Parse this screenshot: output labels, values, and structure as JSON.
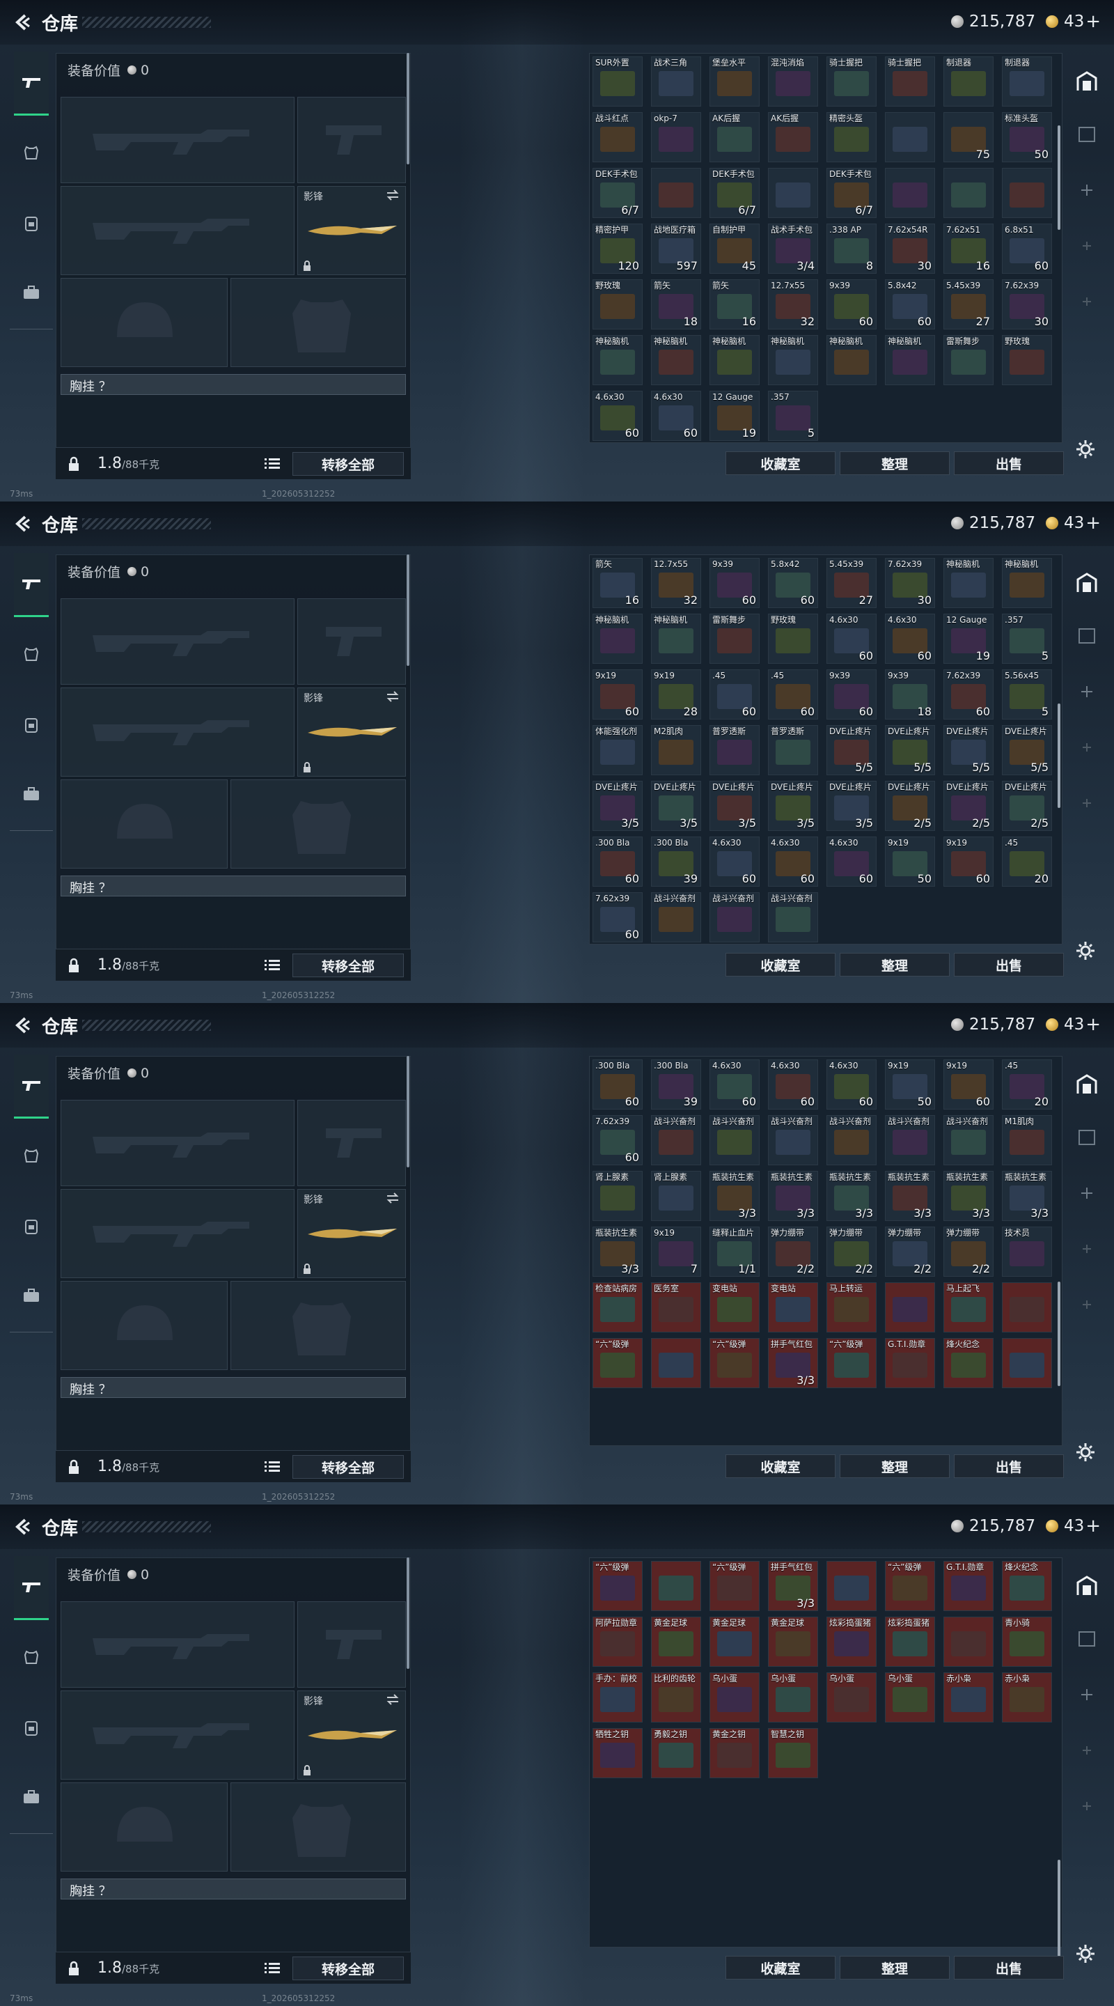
{
  "header": {
    "title": "仓库",
    "silver": "215,787",
    "gold": "43",
    "gold_plus": "+"
  },
  "loadout": {
    "equip_value_label": "装备价值",
    "equip_value": "0",
    "melee_label": "影锋",
    "chest_label": "胸挂 ？",
    "weight": "1.8",
    "weight_cap": "/88千克",
    "transfer_all": "转移全部"
  },
  "inventory_actions": {
    "collection": "收藏室",
    "organize": "整理",
    "sell": "出售"
  },
  "status": {
    "ping": "73ms",
    "build": "1_202605312252"
  },
  "icons": [
    "back-icon",
    "gun-tab-icon",
    "armor-tab-icon",
    "backpack-tab-icon",
    "case-tab-icon",
    "vault-icon",
    "list-icon",
    "lock-icon",
    "swap-icon",
    "gear-icon",
    "plus-icon"
  ],
  "frames": [
    {
      "cells": [
        {
          "name": "SUR外置",
          "count": ""
        },
        {
          "name": "战术三角",
          "count": ""
        },
        {
          "name": "堡垒水平",
          "count": ""
        },
        {
          "name": "混沌消焰",
          "count": ""
        },
        {
          "name": "骑士握把",
          "count": ""
        },
        {
          "name": "骑士握把",
          "count": ""
        },
        {
          "name": "制退器",
          "count": ""
        },
        {
          "name": "制退器",
          "count": ""
        },
        {
          "name": "战斗红点",
          "count": ""
        },
        {
          "name": "okp-7",
          "count": ""
        },
        {
          "name": "AK后握",
          "count": ""
        },
        {
          "name": "AK后握",
          "count": ""
        },
        {
          "name": "精密头盔",
          "count": ""
        },
        {
          "name": "",
          "count": ""
        },
        {
          "name": "",
          "count": "75"
        },
        {
          "name": "标准头盔",
          "count": "50"
        },
        {
          "name": "DEK手术包",
          "count": "6/7"
        },
        {
          "name": "",
          "count": ""
        },
        {
          "name": "DEK手术包",
          "count": "6/7"
        },
        {
          "name": "",
          "count": ""
        },
        {
          "name": "DEK手术包",
          "count": "6/7"
        },
        {
          "name": "",
          "count": ""
        },
        {
          "name": "",
          "count": ""
        },
        {
          "name": "",
          "count": ""
        },
        {
          "name": "精密护甲",
          "count": "120"
        },
        {
          "name": "战地医疗箱",
          "count": "597"
        },
        {
          "name": "自制护甲",
          "count": "45"
        },
        {
          "name": "战术手术包",
          "count": "3/4"
        },
        {
          "name": ".338 AP",
          "count": "8"
        },
        {
          "name": "7.62x54R",
          "count": "30"
        },
        {
          "name": "7.62x51",
          "count": "16"
        },
        {
          "name": "6.8x51",
          "count": "60"
        },
        {
          "name": "野玫瑰",
          "count": ""
        },
        {
          "name": "箭矢",
          "count": "18"
        },
        {
          "name": "箭矢",
          "count": "16"
        },
        {
          "name": "12.7x55",
          "count": "32"
        },
        {
          "name": "9x39",
          "count": "60"
        },
        {
          "name": "5.8x42",
          "count": "60"
        },
        {
          "name": "5.45x39",
          "count": "27"
        },
        {
          "name": "7.62x39",
          "count": "30"
        },
        {
          "name": "神秘脑机",
          "count": ""
        },
        {
          "name": "神秘脑机",
          "count": ""
        },
        {
          "name": "神秘脑机",
          "count": ""
        },
        {
          "name": "神秘脑机",
          "count": ""
        },
        {
          "name": "神秘脑机",
          "count": ""
        },
        {
          "name": "神秘脑机",
          "count": ""
        },
        {
          "name": "雷斯舞步",
          "count": ""
        },
        {
          "name": "野玫瑰",
          "count": ""
        },
        {
          "name": "4.6x30",
          "count": "60"
        },
        {
          "name": "4.6x30",
          "count": "60"
        },
        {
          "name": "12 Gauge",
          "count": "19"
        },
        {
          "name": ".357",
          "count": "5"
        }
      ]
    },
    {
      "cells": [
        {
          "name": "箭矢",
          "count": "16"
        },
        {
          "name": "12.7x55",
          "count": "32"
        },
        {
          "name": "9x39",
          "count": "60"
        },
        {
          "name": "5.8x42",
          "count": "60"
        },
        {
          "name": "5.45x39",
          "count": "27"
        },
        {
          "name": "7.62x39",
          "count": "30"
        },
        {
          "name": "神秘脑机",
          "count": ""
        },
        {
          "name": "神秘脑机",
          "count": ""
        },
        {
          "name": "神秘脑机",
          "count": ""
        },
        {
          "name": "神秘脑机",
          "count": ""
        },
        {
          "name": "雷斯舞步",
          "count": ""
        },
        {
          "name": "野玫瑰",
          "count": ""
        },
        {
          "name": "4.6x30",
          "count": "60"
        },
        {
          "name": "4.6x30",
          "count": "60"
        },
        {
          "name": "12 Gauge",
          "count": "19"
        },
        {
          "name": ".357",
          "count": "5"
        },
        {
          "name": "9x19",
          "count": "60"
        },
        {
          "name": "9x19",
          "count": "28"
        },
        {
          "name": ".45",
          "count": "60"
        },
        {
          "name": ".45",
          "count": "60"
        },
        {
          "name": "9x39",
          "count": "60"
        },
        {
          "name": "9x39",
          "count": "18"
        },
        {
          "name": "7.62x39",
          "count": "60"
        },
        {
          "name": "5.56x45",
          "count": "5"
        },
        {
          "name": "体能强化剂",
          "count": ""
        },
        {
          "name": "M2肌肉",
          "count": ""
        },
        {
          "name": "普罗透斯",
          "count": ""
        },
        {
          "name": "普罗透斯",
          "count": ""
        },
        {
          "name": "DVE止疼片",
          "count": "5/5"
        },
        {
          "name": "DVE止疼片",
          "count": "5/5"
        },
        {
          "name": "DVE止疼片",
          "count": "5/5"
        },
        {
          "name": "DVE止疼片",
          "count": "5/5"
        },
        {
          "name": "DVE止疼片",
          "count": "3/5"
        },
        {
          "name": "DVE止疼片",
          "count": "3/5"
        },
        {
          "name": "DVE止疼片",
          "count": "3/5"
        },
        {
          "name": "DVE止疼片",
          "count": "3/5"
        },
        {
          "name": "DVE止疼片",
          "count": "3/5"
        },
        {
          "name": "DVE止疼片",
          "count": "2/5"
        },
        {
          "name": "DVE止疼片",
          "count": "2/5"
        },
        {
          "name": "DVE止疼片",
          "count": "2/5"
        },
        {
          "name": ".300 Bla",
          "count": "60"
        },
        {
          "name": ".300 Bla",
          "count": "39"
        },
        {
          "name": "4.6x30",
          "count": "60"
        },
        {
          "name": "4.6x30",
          "count": "60"
        },
        {
          "name": "4.6x30",
          "count": "60"
        },
        {
          "name": "9x19",
          "count": "50"
        },
        {
          "name": "9x19",
          "count": "60"
        },
        {
          "name": ".45",
          "count": "20"
        },
        {
          "name": "7.62x39",
          "count": "60"
        },
        {
          "name": "战斗兴奋剂",
          "count": ""
        },
        {
          "name": "战斗兴奋剂",
          "count": ""
        },
        {
          "name": "战斗兴奋剂",
          "count": ""
        }
      ]
    },
    {
      "cells": [
        {
          "name": ".300 Bla",
          "count": "60"
        },
        {
          "name": ".300 Bla",
          "count": "39"
        },
        {
          "name": "4.6x30",
          "count": "60"
        },
        {
          "name": "4.6x30",
          "count": "60"
        },
        {
          "name": "4.6x30",
          "count": "60"
        },
        {
          "name": "9x19",
          "count": "50"
        },
        {
          "name": "9x19",
          "count": "60"
        },
        {
          "name": ".45",
          "count": "20"
        },
        {
          "name": "7.62x39",
          "count": "60"
        },
        {
          "name": "战斗兴奋剂",
          "count": ""
        },
        {
          "name": "战斗兴奋剂",
          "count": ""
        },
        {
          "name": "战斗兴奋剂",
          "count": ""
        },
        {
          "name": "战斗兴奋剂",
          "count": ""
        },
        {
          "name": "战斗兴奋剂",
          "count": ""
        },
        {
          "name": "战斗兴奋剂",
          "count": ""
        },
        {
          "name": "M1肌肉",
          "count": ""
        },
        {
          "name": "肾上腺素",
          "count": ""
        },
        {
          "name": "肾上腺素",
          "count": ""
        },
        {
          "name": "瓶装抗生素",
          "count": "3/3"
        },
        {
          "name": "瓶装抗生素",
          "count": "3/3"
        },
        {
          "name": "瓶装抗生素",
          "count": "3/3"
        },
        {
          "name": "瓶装抗生素",
          "count": "3/3"
        },
        {
          "name": "瓶装抗生素",
          "count": "3/3"
        },
        {
          "name": "瓶装抗生素",
          "count": "3/3"
        },
        {
          "name": "瓶装抗生素",
          "count": "3/3"
        },
        {
          "name": "9x19",
          "count": "7"
        },
        {
          "name": "缝释止血片",
          "count": "1/1"
        },
        {
          "name": "弹力绷带",
          "count": "2/2"
        },
        {
          "name": "弹力绷带",
          "count": "2/2"
        },
        {
          "name": "弹力绷带",
          "count": "2/2"
        },
        {
          "name": "弹力绷带",
          "count": "2/2"
        },
        {
          "name": "技术员",
          "count": ""
        },
        {
          "name": "检查站病房",
          "count": ""
        },
        {
          "name": "医务室",
          "count": ""
        },
        {
          "name": "变电站",
          "count": ""
        },
        {
          "name": "变电站",
          "count": ""
        },
        {
          "name": "马上转运",
          "count": ""
        },
        {
          "name": "",
          "count": ""
        },
        {
          "name": "马上起飞",
          "count": ""
        },
        {
          "name": "",
          "count": ""
        },
        {
          "name": "“六”级弹",
          "count": ""
        },
        {
          "name": "",
          "count": ""
        },
        {
          "name": "“六”级弹",
          "count": ""
        },
        {
          "name": "拼手气红包",
          "count": "3/3"
        },
        {
          "name": "“六”级弹",
          "count": ""
        },
        {
          "name": "G.T.I.勋章",
          "count": ""
        },
        {
          "name": "烽火纪念",
          "count": ""
        },
        {
          "name": "",
          "count": ""
        }
      ]
    },
    {
      "cells": [
        {
          "name": "“六”级弹",
          "count": ""
        },
        {
          "name": "",
          "count": ""
        },
        {
          "name": "“六”级弹",
          "count": ""
        },
        {
          "name": "拼手气红包",
          "count": "3/3"
        },
        {
          "name": "",
          "count": ""
        },
        {
          "name": "“六”级弹",
          "count": ""
        },
        {
          "name": "G.T.I.勋章",
          "count": ""
        },
        {
          "name": "烽火纪念",
          "count": ""
        },
        {
          "name": "阿萨拉勋章",
          "count": ""
        },
        {
          "name": "黄金足球",
          "count": ""
        },
        {
          "name": "黄金足球",
          "count": ""
        },
        {
          "name": "黄金足球",
          "count": ""
        },
        {
          "name": "炫彩捣蛋猪",
          "count": ""
        },
        {
          "name": "炫彩捣蛋猪",
          "count": ""
        },
        {
          "name": "",
          "count": ""
        },
        {
          "name": "青小骑",
          "count": ""
        },
        {
          "name": "手办：前校（崛起）",
          "count": ""
        },
        {
          "name": "比利的齿轮",
          "count": ""
        },
        {
          "name": "乌小蛋",
          "count": ""
        },
        {
          "name": "乌小蛋",
          "count": ""
        },
        {
          "name": "乌小蛋",
          "count": ""
        },
        {
          "name": "乌小蛋",
          "count": ""
        },
        {
          "name": "赤小枭",
          "count": ""
        },
        {
          "name": "赤小枭",
          "count": ""
        },
        {
          "name": "牺牲之钥",
          "count": ""
        },
        {
          "name": "勇毅之钥",
          "count": ""
        },
        {
          "name": "黄金之钥",
          "count": ""
        },
        {
          "name": "智慧之钥",
          "count": ""
        }
      ]
    }
  ]
}
